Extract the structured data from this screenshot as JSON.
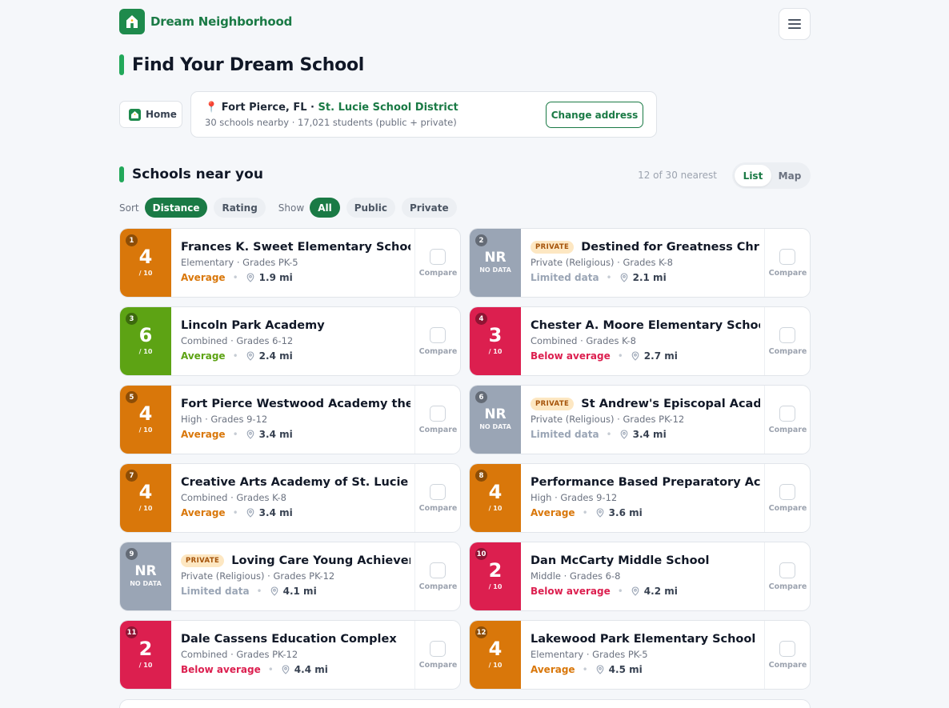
{
  "brand": {
    "name": "Dream Neighborhood",
    "color": "#1e8a4c"
  },
  "page": {
    "title": "Find Your Dream School"
  },
  "location": {
    "home_label": "Home",
    "city": "Fort Pierce, FL",
    "separator": " · ",
    "district": "St. Lucie School District",
    "summary": "30 schools nearby · 17,021 students (public + private)",
    "change_label": "Change address"
  },
  "section": {
    "title": "Schools near you",
    "count_text": "12 of 30 nearest",
    "views": [
      "List",
      "Map"
    ],
    "active_view": "List"
  },
  "filters": {
    "sort_label": "Sort",
    "sort_options": [
      "Distance",
      "Rating"
    ],
    "sort_active": "Distance",
    "show_label": "Show",
    "show_options": [
      "All",
      "Public",
      "Private"
    ],
    "show_active": "All"
  },
  "compare_label": "Compare",
  "private_badge": "PRIVATE",
  "schools": [
    {
      "rank": "1",
      "score": "4",
      "score_sub": "/ 10",
      "tier": "orange",
      "private": false,
      "name": "Frances K. Sweet Elementary School",
      "meta": "Elementary · Grades PK-5",
      "label": "Average",
      "distance": "1.9 mi"
    },
    {
      "rank": "2",
      "score": "NR",
      "score_sub": "NO DATA",
      "tier": "gray",
      "private": true,
      "name": "Destined for Greatness Christian Academy",
      "meta": "Private (Religious) · Grades K-8",
      "label": "Limited data",
      "distance": "2.1 mi"
    },
    {
      "rank": "3",
      "score": "6",
      "score_sub": "/ 10",
      "tier": "green",
      "private": false,
      "name": "Lincoln Park Academy",
      "meta": "Combined · Grades 6-12",
      "label": "Average",
      "distance": "2.4 mi"
    },
    {
      "rank": "4",
      "score": "3",
      "score_sub": "/ 10",
      "tier": "red",
      "private": false,
      "name": "Chester A. Moore Elementary School",
      "meta": "Combined · Grades K-8",
      "label": "Below average",
      "distance": "2.7 mi"
    },
    {
      "rank": "5",
      "score": "4",
      "score_sub": "/ 10",
      "tier": "orange",
      "private": false,
      "name": "Fort Pierce Westwood Academy the W.",
      "meta": "High · Grades 9-12",
      "label": "Average",
      "distance": "3.4 mi"
    },
    {
      "rank": "6",
      "score": "NR",
      "score_sub": "NO DATA",
      "tier": "gray",
      "private": true,
      "name": "St Andrew's Episcopal Academy",
      "meta": "Private (Religious) · Grades PK-12",
      "label": "Limited data",
      "distance": "3.4 mi"
    },
    {
      "rank": "7",
      "score": "4",
      "score_sub": "/ 10",
      "tier": "orange",
      "private": false,
      "name": "Creative Arts Academy of St. Lucie",
      "meta": "Combined · Grades K-8",
      "label": "Average",
      "distance": "3.4 mi"
    },
    {
      "rank": "8",
      "score": "4",
      "score_sub": "/ 10",
      "tier": "orange",
      "private": false,
      "name": "Performance Based Preparatory Academy",
      "meta": "High · Grades 9-12",
      "label": "Average",
      "distance": "3.6 mi"
    },
    {
      "rank": "9",
      "score": "NR",
      "score_sub": "NO DATA",
      "tier": "gray",
      "private": true,
      "name": "Loving Care Young Achievers Christian Academy",
      "meta": "Private (Religious) · Grades PK-12",
      "label": "Limited data",
      "distance": "4.1 mi"
    },
    {
      "rank": "10",
      "score": "2",
      "score_sub": "/ 10",
      "tier": "red",
      "private": false,
      "name": "Dan McCarty Middle School",
      "meta": "Middle · Grades 6-8",
      "label": "Below average",
      "distance": "4.2 mi"
    },
    {
      "rank": "11",
      "score": "2",
      "score_sub": "/ 10",
      "tier": "red",
      "private": false,
      "name": "Dale Cassens Education Complex",
      "meta": "Combined · Grades PK-12",
      "label": "Below average",
      "distance": "4.4 mi"
    },
    {
      "rank": "12",
      "score": "4",
      "score_sub": "/ 10",
      "tier": "orange",
      "private": false,
      "name": "Lakewood Park Elementary School",
      "meta": "Elementary · Grades PK-5",
      "label": "Average",
      "distance": "4.5 mi"
    }
  ],
  "colors": {
    "orange": "#d9770a",
    "green": "#5da314",
    "red": "#dc1f4f",
    "gray": "#9aa5b5"
  }
}
